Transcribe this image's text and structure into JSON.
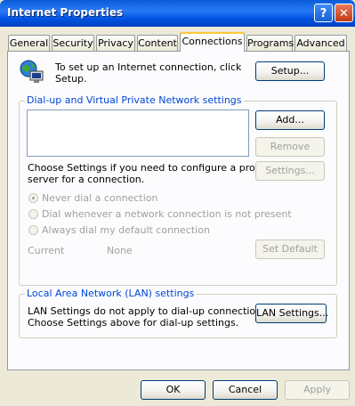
{
  "window": {
    "title": "Internet Properties",
    "help_glyph": "?",
    "close_glyph": "✕"
  },
  "tabs": [
    {
      "label": "General"
    },
    {
      "label": "Security"
    },
    {
      "label": "Privacy"
    },
    {
      "label": "Content"
    },
    {
      "label": "Connections",
      "selected": true
    },
    {
      "label": "Programs"
    },
    {
      "label": "Advanced"
    }
  ],
  "setup": {
    "description": "To set up an Internet connection, click\nSetup.",
    "line1": "To set up an Internet connection, click",
    "line2": "Setup.",
    "button": "Setup...",
    "icon": "network-globe-icon"
  },
  "dialup": {
    "group_label": "Dial-up and Virtual Private Network settings",
    "add_button": "Add...",
    "remove_button": "Remove",
    "settings_button": "Settings...",
    "proxy_line1": "Choose Settings if you need to configure a proxy",
    "proxy_line2": "server for a connection.",
    "options": [
      {
        "label": "Never dial a connection",
        "selected": true
      },
      {
        "label": "Dial whenever a network connection is not present",
        "selected": false
      },
      {
        "label": "Always dial my default connection",
        "selected": false
      }
    ],
    "current_label": "Current",
    "current_value": "None",
    "set_default_button": "Set Default"
  },
  "lan": {
    "group_label": "Local Area Network (LAN) settings",
    "line1": "LAN Settings do not apply to dial-up connections.",
    "line2": "Choose Settings above for dial-up settings.",
    "button": "LAN Settings..."
  },
  "footer": {
    "ok": "OK",
    "cancel": "Cancel",
    "apply": "Apply"
  },
  "colors": {
    "titlebar": "#0054e3",
    "dialog_bg": "#ece9d8",
    "group_label": "#0046d5",
    "disabled_text": "#a0a0a0",
    "active_tab_accent": "#ffc83c"
  }
}
